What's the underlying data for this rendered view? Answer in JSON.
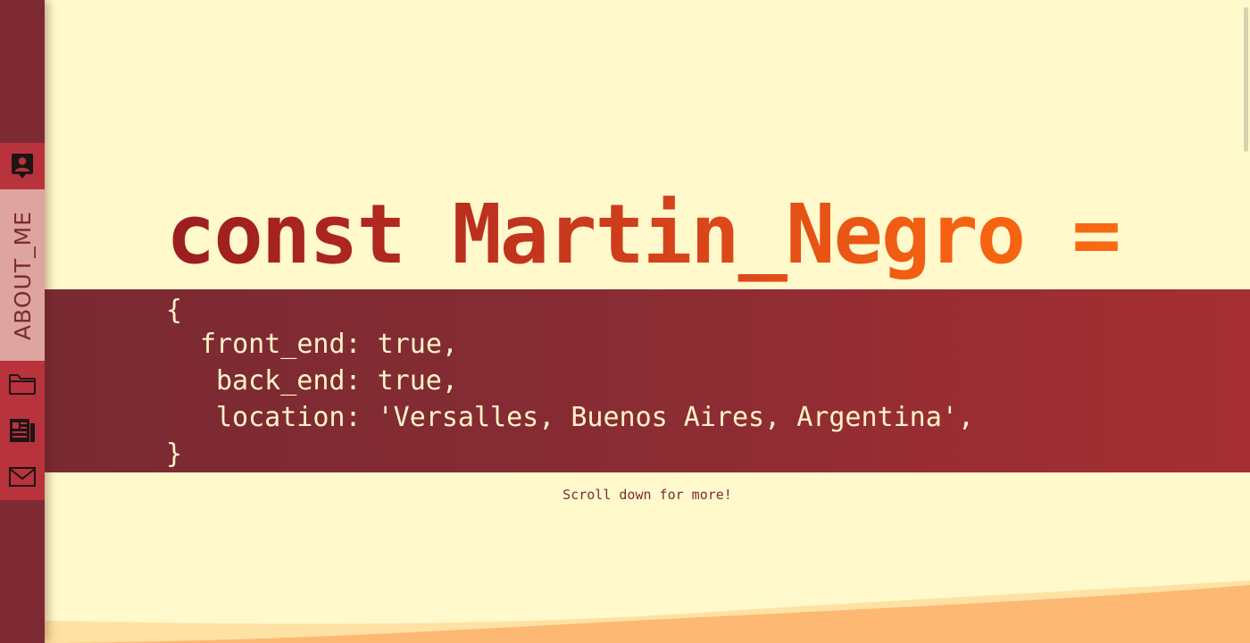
{
  "sidebar": {
    "items": [
      {
        "id": "profile",
        "icon": "profile-icon"
      },
      {
        "id": "about",
        "label": "ABOUT_ME",
        "active": true
      },
      {
        "id": "projects",
        "icon": "folder-icon"
      },
      {
        "id": "articles",
        "icon": "newspaper-icon"
      },
      {
        "id": "contact",
        "icon": "mail-icon"
      }
    ]
  },
  "hero": {
    "headline": "const Martin_Negro =",
    "code_lines": [
      "{",
      "front_end: true,",
      "back_end: true,",
      "location: 'Versalles, Buenos Aires, Argentina',",
      "}"
    ],
    "scroll_hint": "Scroll down for more!"
  },
  "colors": {
    "background": "#fff9cc",
    "sidebar": "#7d2a33",
    "sidebar_item": "#b8333c",
    "sidebar_active": "#dea5a0",
    "code_band_start": "#7a2a33",
    "code_band_end": "#a62f33",
    "headline_start": "#9b1d20",
    "headline_end": "#fa6a10",
    "wave": "#fdb874"
  }
}
